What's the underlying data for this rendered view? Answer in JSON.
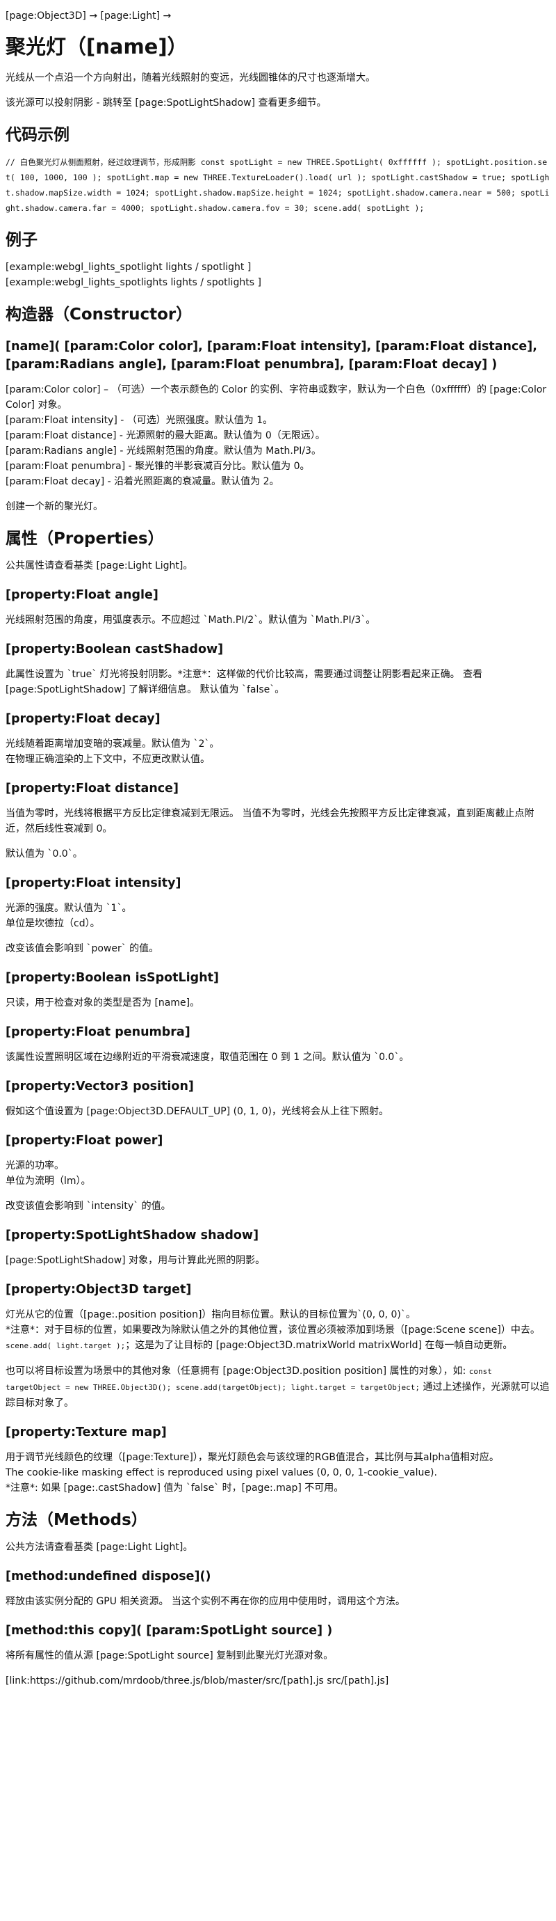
{
  "breadcrumb": "[page:Object3D] → [page:Light] →",
  "title": "聚光灯（[name]）",
  "intro": "光线从一个点沿一个方向射出，随着光线照射的变远，光线圆锥体的尺寸也逐渐增大。",
  "shadow_note": "该光源可以投射阴影 - 跳转至 [page:SpotLightShadow] 查看更多细节。",
  "sections": {
    "code": {
      "heading": "代码示例",
      "code": "// 白色聚光灯从侧面照射，经过纹理调节，形成阴影 const spotLight = new THREE.SpotLight( 0xffffff ); spotLight.position.set( 100, 1000, 100 ); spotLight.map = new THREE.TextureLoader().load( url ); spotLight.castShadow = true; spotLight.shadow.mapSize.width = 1024; spotLight.shadow.mapSize.height = 1024; spotLight.shadow.camera.near = 500; spotLight.shadow.camera.far = 4000; spotLight.shadow.camera.fov = 30; scene.add( spotLight );"
    },
    "examples": {
      "heading": "例子",
      "lines": [
        "[example:webgl_lights_spotlight lights / spotlight ]",
        "[example:webgl_lights_spotlights lights / spotlights ]"
      ]
    },
    "constructor": {
      "heading": "构造器（Constructor）",
      "signature": "[name]( [param:Color color], [param:Float intensity], [param:Float distance], [param:Radians angle], [param:Float penumbra], [param:Float decay] )",
      "params": [
        "[param:Color color] – （可选）一个表示颜色的 Color 的实例、字符串或数字，默认为一个白色（0xffffff）的 [page:Color Color] 对象。",
        "[param:Float intensity] - （可选）光照强度。默认值为 1。",
        "[param:Float distance] - 光源照射的最大距离。默认值为 0（无限远）。",
        "[param:Radians angle] - 光线照射范围的角度。默认值为 Math.PI/3。",
        "[param:Float penumbra] - 聚光锥的半影衰减百分比。默认值为 0。",
        "[param:Float decay] - 沿着光照距离的衰减量。默认值为 2。"
      ],
      "note": "创建一个新的聚光灯。"
    },
    "properties": {
      "heading": "属性（Properties）",
      "intro": "公共属性请查看基类 [page:Light Light]。",
      "angle": {
        "heading": "[property:Float angle]",
        "desc": "光线照射范围的角度，用弧度表示。不应超过 `Math.PI/2`。默认值为 `Math.PI/3`。"
      },
      "castShadow": {
        "heading": "[property:Boolean castShadow]",
        "desc": "此属性设置为 `true` 灯光将投射阴影。*注意*：这样做的代价比较高，需要通过调整让阴影看起来正确。 查看 [page:SpotLightShadow] 了解详细信息。 默认值为 `false`。"
      },
      "decay": {
        "heading": "[property:Float decay]",
        "lines": [
          "光线随着距离增加变暗的衰减量。默认值为 `2`。",
          "在物理正确渲染的上下文中，不应更改默认值。"
        ]
      },
      "distance": {
        "heading": "[property:Float distance]",
        "desc": "当值为零时，光线将根据平方反比定律衰减到无限远。 当值不为零时，光线会先按照平方反比定律衰减，直到距离截止点附近，然后线性衰减到 0。",
        "default": "默认值为 `0.0`。"
      },
      "intensity": {
        "heading": "[property:Float intensity]",
        "lines": [
          "光源的强度。默认值为 `1`。",
          "单位是坎德拉（cd）。"
        ],
        "note": "改变该值会影响到 `power` 的值。"
      },
      "isSpotLight": {
        "heading": "[property:Boolean isSpotLight]",
        "desc": "只读，用于检查对象的类型是否为 [name]。"
      },
      "penumbra": {
        "heading": "[property:Float penumbra]",
        "desc": "该属性设置照明区域在边缘附近的平滑衰减速度，取值范围在 0 到 1 之间。默认值为 `0.0`。"
      },
      "position": {
        "heading": "[property:Vector3 position]",
        "desc": "假如这个值设置为 [page:Object3D.DEFAULT_UP] (0, 1, 0)，光线将会从上往下照射。"
      },
      "power": {
        "heading": "[property:Float power]",
        "lines": [
          "光源的功率。",
          "单位为流明（lm）。"
        ],
        "note": "改变该值会影响到 `intensity` 的值。"
      },
      "shadow": {
        "heading": "[property:SpotLightShadow shadow]",
        "desc": "[page:SpotLightShadow] 对象，用与计算此光照的阴影。"
      },
      "target": {
        "heading": "[property:Object3D target]",
        "p1_a": "灯光从它的位置（[page:.position position]）指向目标位置。默认的目标位置为`(0, 0, 0)`。",
        "p1_b": "*注意*：对于目标的位置，如果要改为除默认值之外的其他位置，该位置必须被添加到场景（[page:Scene scene]）中去。",
        "p1_code": "scene.add( light.target );",
        "p1_c": "这是为了让目标的 [page:Object3D.matrixWorld matrixWorld] 在每一帧自动更新。",
        "p2_a": "也可以将目标设置为场景中的其他对象（任意拥有 [page:Object3D.position position] 属性的对象），如:",
        "p2_code": "const targetObject = new THREE.Object3D(); scene.add(targetObject); light.target = targetObject;",
        "p2_b": "通过上述操作，光源就可以追踪目标对象了。"
      },
      "map": {
        "heading": "[property:Texture map]",
        "lines": [
          "用于调节光线颜色的纹理（[page:Texture]），聚光灯颜色会与该纹理的RGB值混合，其比例与其alpha值相对应。",
          "The cookie-like masking effect is reproduced using pixel values (0, 0, 0, 1-cookie_value).",
          "*注意*: 如果 [page:.castShadow] 值为 `false` 时，[page:.map] 不可用。"
        ]
      }
    },
    "methods": {
      "heading": "方法（Methods）",
      "intro": "公共方法请查看基类 [page:Light Light]。",
      "dispose": {
        "heading": "[method:undefined dispose]()",
        "desc": "释放由该实例分配的 GPU 相关资源。 当这个实例不再在你的应用中使用时，调用这个方法。"
      },
      "copy": {
        "heading": "[method:this copy]( [param:SpotLight source] )",
        "desc": "将所有属性的值从源 [page:SpotLight source] 复制到此聚光灯光源对象。"
      }
    },
    "source": {
      "link": "[link:https://github.com/mrdoob/three.js/blob/master/src/[path].js src/[path].js]"
    }
  }
}
